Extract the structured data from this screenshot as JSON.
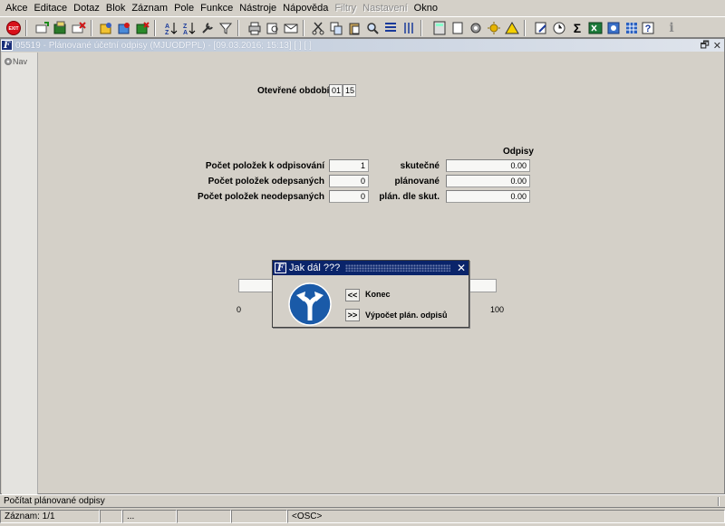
{
  "menubar": {
    "items": [
      {
        "label": "Akce",
        "enabled": true
      },
      {
        "label": "Editace",
        "enabled": true
      },
      {
        "label": "Dotaz",
        "enabled": true
      },
      {
        "label": "Blok",
        "enabled": true
      },
      {
        "label": "Záznam",
        "enabled": true
      },
      {
        "label": "Pole",
        "enabled": true
      },
      {
        "label": "Funkce",
        "enabled": true
      },
      {
        "label": "Nástroje",
        "enabled": true
      },
      {
        "label": "Nápověda",
        "enabled": true
      },
      {
        "label": "Filtry",
        "enabled": false
      },
      {
        "label": "Nastavení",
        "enabled": false
      },
      {
        "label": "Okno",
        "enabled": true
      }
    ]
  },
  "toolbar": {
    "exit_label": "EXIT",
    "sum_glyph": "Σ",
    "info_glyph": "i",
    "help_glyph": "?"
  },
  "window": {
    "logo_text": "F",
    "title": "05519 - Plánované účetní odpisy (MJUODPPL) - [09.03.2016; 15:13]  [ ] [ ]",
    "restore_glyph": "🗗",
    "close_glyph": "✕"
  },
  "nav": {
    "label": "Nav"
  },
  "form": {
    "period_label": "Otevřené období",
    "period_month": "01",
    "period_year": "15",
    "odpisy_header": "Odpisy",
    "rows": [
      {
        "label": "Počet položek k odpisování",
        "count": "1",
        "right_label": "skutečné",
        "amount": "0.00"
      },
      {
        "label": "Počet položek odepsaných",
        "count": "0",
        "right_label": "plánované",
        "amount": "0.00"
      },
      {
        "label": "Počet položek neodepsaných",
        "count": "0",
        "right_label": "plán. dle skut.",
        "amount": "0.00"
      }
    ],
    "progress_min": "0",
    "progress_max": "100",
    "progress_value": 0
  },
  "dialog": {
    "logo_text": "F",
    "title": "Jak dál ???",
    "close_glyph": "✕",
    "options": [
      {
        "button": "<<",
        "label": "Konec"
      },
      {
        "button": ">>",
        "label": "Výpočet plán. odpisů"
      }
    ]
  },
  "status": {
    "message": "Počítat plánované odpisy",
    "record": "Záznam: 1/1",
    "cell_3": "...",
    "mode": "<OSC>"
  },
  "colors": {
    "dialog_title_bg": "#0a246a",
    "sign_blue": "#1a5aa8"
  }
}
